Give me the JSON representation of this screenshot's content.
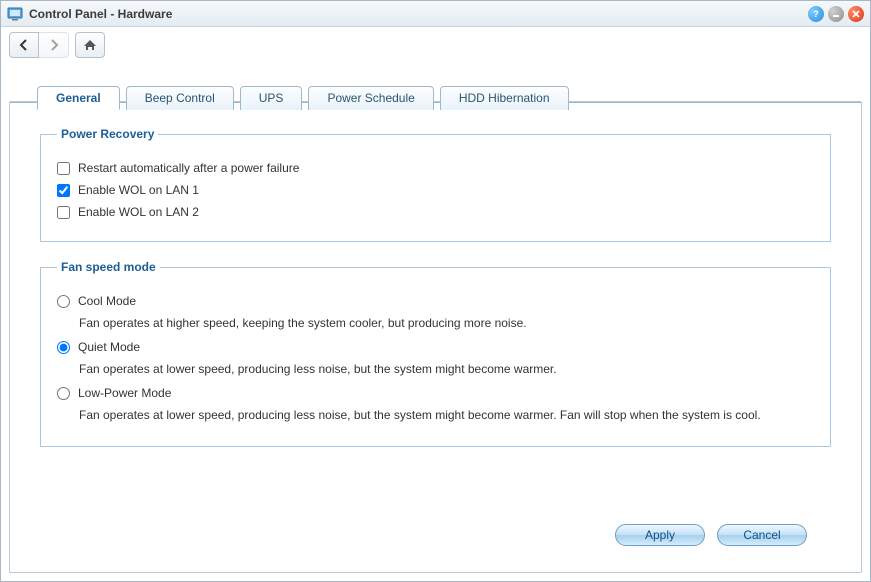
{
  "window": {
    "title": "Control Panel - Hardware"
  },
  "tabs": [
    {
      "label": "General"
    },
    {
      "label": "Beep Control"
    },
    {
      "label": "UPS"
    },
    {
      "label": "Power Schedule"
    },
    {
      "label": "HDD Hibernation"
    }
  ],
  "power_recovery": {
    "legend": "Power Recovery",
    "restart_auto": {
      "label": "Restart automatically after a power failure",
      "checked": false
    },
    "wol_lan1": {
      "label": "Enable WOL on LAN 1",
      "checked": true
    },
    "wol_lan2": {
      "label": "Enable WOL on LAN 2",
      "checked": false
    }
  },
  "fan_speed": {
    "legend": "Fan speed mode",
    "selected": "quiet",
    "cool": {
      "label": "Cool Mode",
      "desc": "Fan operates at higher speed, keeping the system cooler, but producing more noise."
    },
    "quiet": {
      "label": "Quiet Mode",
      "desc": "Fan operates at lower speed, producing less noise, but the system might become warmer."
    },
    "lowpower": {
      "label": "Low-Power Mode",
      "desc": "Fan operates at lower speed, producing less noise, but the system might become warmer. Fan will stop when the system is cool."
    }
  },
  "buttons": {
    "apply": "Apply",
    "cancel": "Cancel"
  }
}
